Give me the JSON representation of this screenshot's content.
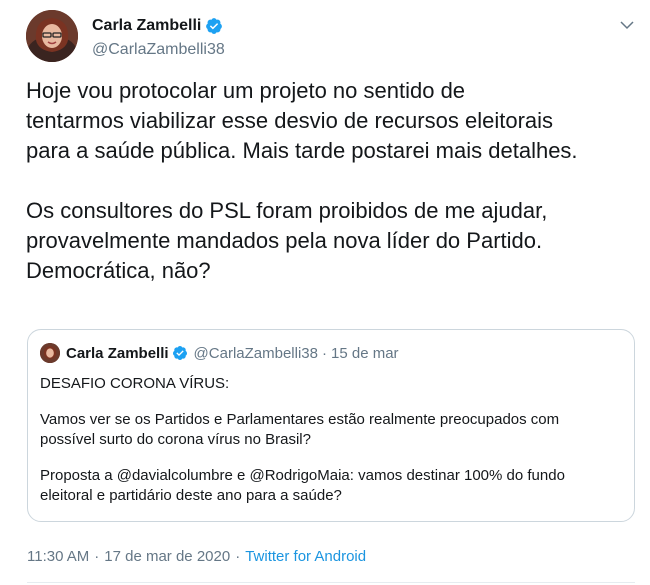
{
  "tweet": {
    "author": {
      "display_name": "Carla Zambelli",
      "handle": "@CarlaZambelli38",
      "verified": true
    },
    "icons": {
      "verified": "verified-badge-icon",
      "menu": "chevron-down-icon"
    },
    "body": {
      "p1": [
        "Hoje vou protocolar um projeto no sentido de",
        "tentarmos viabilizar esse desvio de recursos eleitorais",
        "para a saúde pública. Mais tarde postarei mais detalhes."
      ],
      "p2": [
        "Os consultores do PSL foram proibidos de me ajudar,",
        "provavelmente mandados pela nova líder do Partido.",
        "Democrática, não?"
      ]
    },
    "quoted": {
      "display_name": "Carla Zambelli",
      "handle": "@CarlaZambelli38",
      "separator": "·",
      "date": "15 de mar",
      "body": {
        "l1": "DESAFIO CORONA VÍRUS:",
        "p2": [
          "Vamos ver se os Partidos e Parlamentares estão realmente preocupados com",
          "possível surto do corona vírus no Brasil?"
        ],
        "p3": [
          "Proposta a @davialcolumbre e @RodrigoMaia: vamos destinar 100% do fundo",
          "eleitoral e partidário deste ano para a saúde?"
        ]
      }
    },
    "meta": {
      "time": "11:30 AM",
      "date": "17 de mar de 2020",
      "separator": "·",
      "source": "Twitter for Android"
    }
  },
  "colors": {
    "text": "#14171a",
    "secondary": "#657786",
    "accent": "#1b95e0",
    "border": "#ccd6dd"
  }
}
